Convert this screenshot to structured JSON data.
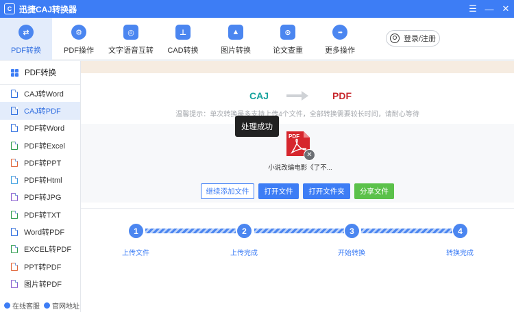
{
  "app": {
    "title": "迅捷CAJ转换器",
    "logo_glyph": "C"
  },
  "window_controls": [
    "☰",
    "—",
    "✕"
  ],
  "toolbar": {
    "items": [
      {
        "label": "PDF转换",
        "icon": "swap-icon",
        "glyph": "⇄"
      },
      {
        "label": "PDF操作",
        "icon": "gear-icon",
        "glyph": "⚙"
      },
      {
        "label": "文字语音互转",
        "icon": "voice-icon",
        "glyph": "◎"
      },
      {
        "label": "CAD转换",
        "icon": "cad-icon",
        "glyph": "⊥"
      },
      {
        "label": "图片转换",
        "icon": "image-icon",
        "glyph": "▲"
      },
      {
        "label": "论文查重",
        "icon": "search-doc-icon",
        "glyph": "⊙"
      },
      {
        "label": "更多操作",
        "icon": "more-icon",
        "glyph": "•••"
      }
    ],
    "login_label": "登录/注册"
  },
  "sidebar": {
    "header": "PDF转换",
    "items": [
      {
        "label": "CAJ转Word",
        "color": "#2b6de0"
      },
      {
        "label": "CAJ转PDF",
        "color": "#2b6de0"
      },
      {
        "label": "PDF转Word",
        "color": "#2b6de0"
      },
      {
        "label": "PDF转Excel",
        "color": "#2e9b4e"
      },
      {
        "label": "PDF转PPT",
        "color": "#e0663a"
      },
      {
        "label": "PDF转Html",
        "color": "#3a9ee0"
      },
      {
        "label": "PDF转JPG",
        "color": "#8a5fd0"
      },
      {
        "label": "PDF转TXT",
        "color": "#2e9b4e"
      },
      {
        "label": "Word转PDF",
        "color": "#2b6de0"
      },
      {
        "label": "EXCEL转PDF",
        "color": "#2e9b4e"
      },
      {
        "label": "PPT转PDF",
        "color": "#e0663a"
      },
      {
        "label": "图片转PDF",
        "color": "#8a5fd0"
      }
    ],
    "footer": {
      "service": "在线客服",
      "website": "官网地址"
    }
  },
  "main": {
    "from_format": "CAJ",
    "to_format": "PDF",
    "tip": "温馨提示：单次转换最多支持上传4个文件，全部转换需要较长时间，请耐心等待",
    "toast": "处理成功",
    "file": {
      "badge": "PDF",
      "name": "小说改编电影《了不..."
    },
    "buttons": {
      "add_more": "继续添加文件",
      "open_file": "打开文件",
      "open_folder": "打开文件夹",
      "share": "分享文件"
    },
    "steps": [
      {
        "num": "1",
        "label": "上传文件"
      },
      {
        "num": "2",
        "label": "上传完成"
      },
      {
        "num": "3",
        "label": "开始转换"
      },
      {
        "num": "4",
        "label": "转换完成"
      }
    ]
  },
  "colors": {
    "accent": "#3d7df5",
    "caj": "#16a29c",
    "pdf": "#c7262c",
    "success": "#5bc14a"
  }
}
